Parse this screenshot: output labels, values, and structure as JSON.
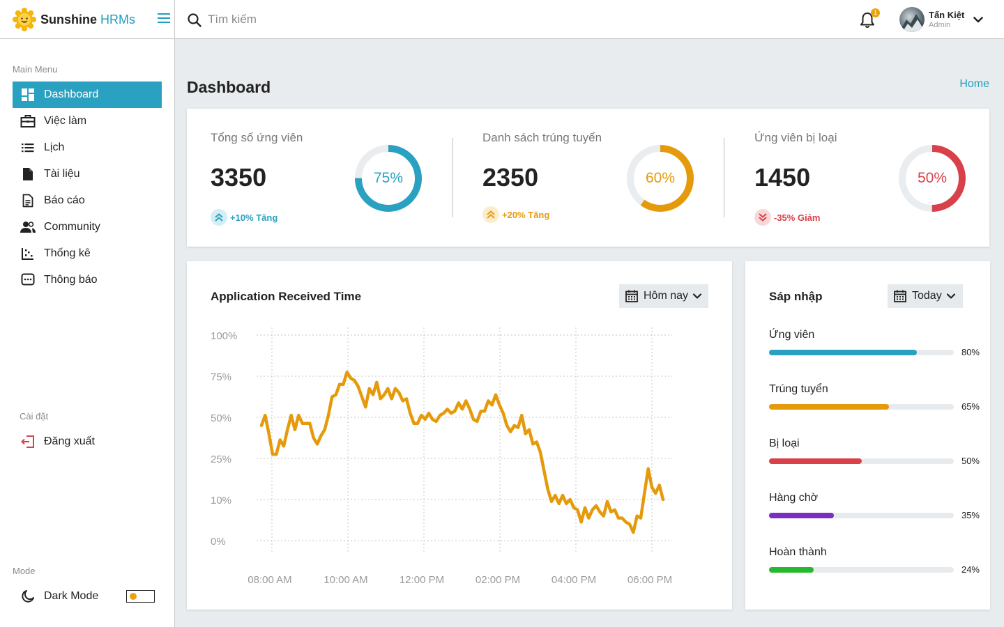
{
  "brand": {
    "name_part1": "Sunshine",
    "name_part2": "HRMs"
  },
  "search": {
    "placeholder": "Tìm kiếm"
  },
  "notifications": {
    "count": "1"
  },
  "user": {
    "name": "Tấn Kiệt",
    "role": "Admin"
  },
  "sidebar": {
    "main_menu_label": "Main Menu",
    "items": [
      {
        "label": "Dashboard",
        "icon": "dashboard-icon",
        "active": true
      },
      {
        "label": "Việc làm",
        "icon": "briefcase-icon"
      },
      {
        "label": "Lịch",
        "icon": "list-icon"
      },
      {
        "label": "Tài liệu",
        "icon": "file-icon"
      },
      {
        "label": "Báo cáo",
        "icon": "report-icon"
      },
      {
        "label": "Community",
        "icon": "community-icon"
      },
      {
        "label": "Thống kê",
        "icon": "scatter-chart-icon"
      },
      {
        "label": "Thông báo",
        "icon": "message-icon"
      }
    ],
    "settings_label": "Cài đặt",
    "logout_label": "Đăng xuất",
    "mode_label": "Mode",
    "dark_mode_label": "Dark Mode",
    "dark_mode_on": false
  },
  "page": {
    "title": "Dashboard",
    "breadcrumb_home": "Home"
  },
  "stats": [
    {
      "title": "Tổng số ứng viên",
      "value": "3350",
      "percent": 75,
      "percent_label": "75%",
      "trend": "+10% Tăng",
      "direction": "up",
      "color": "#2aa1c0",
      "trend_bg": "#d5edf4"
    },
    {
      "title": "Danh sách trúng tuyển",
      "value": "2350",
      "percent": 60,
      "percent_label": "60%",
      "trend": "+20% Tăng",
      "direction": "up",
      "color": "#e59a0c",
      "trend_bg": "#fbeccd"
    },
    {
      "title": "Ứng viên bị loại",
      "value": "1450",
      "percent": 50,
      "percent_label": "50%",
      "trend": "-35% Giảm",
      "direction": "down",
      "color": "#d9414a",
      "trend_bg": "#f8d7d9"
    }
  ],
  "application_chart": {
    "title": "Application Received Time",
    "filter": "Hôm nay"
  },
  "chart_data": {
    "type": "line",
    "title": "Application Received Time",
    "y_tick_labels": [
      "100%",
      "75%",
      "50%",
      "25%",
      "10%",
      "0%"
    ],
    "x_tick_labels": [
      "08:00 AM",
      "10:00 AM",
      "12:00 PM",
      "02:00 PM",
      "04:00 PM",
      "06:00 PM"
    ],
    "y_scale_note": "non-linear labels; values given in tick-band position 0-5 (0=0%,1=10%,2=25%,3=50%,4=75%,5=100%)",
    "x_range": [
      "07:45 AM",
      "06:30 PM"
    ],
    "series": [
      {
        "color": "#e59a0c",
        "values": [
          2.8,
          3.05,
          2.6,
          2.1,
          2.1,
          2.45,
          2.3,
          2.7,
          3.05,
          2.7,
          3.05,
          2.85,
          2.85,
          2.85,
          2.5,
          2.35,
          2.55,
          2.7,
          3.05,
          3.5,
          3.55,
          3.8,
          3.8,
          4.1,
          3.95,
          3.9,
          3.75,
          3.5,
          3.25,
          3.7,
          3.55,
          3.85,
          3.45,
          3.55,
          3.7,
          3.45,
          3.7,
          3.6,
          3.4,
          3.45,
          3.1,
          2.85,
          2.85,
          3.05,
          2.95,
          3.1,
          2.95,
          2.9,
          3.05,
          3.1,
          3.2,
          3.1,
          3.15,
          3.35,
          3.2,
          3.4,
          3.2,
          2.95,
          2.9,
          3.15,
          3.15,
          3.4,
          3.3,
          3.55,
          3.3,
          3.1,
          2.8,
          2.65,
          2.8,
          2.75,
          3.05,
          2.6,
          2.7,
          2.35,
          2.4,
          2.15,
          1.7,
          1.25,
          0.95,
          1.1,
          0.9,
          1.1,
          0.9,
          1.0,
          0.8,
          0.75,
          0.45,
          0.8,
          0.55,
          0.75,
          0.85,
          0.7,
          0.6,
          0.95,
          0.7,
          0.75,
          0.55,
          0.55,
          0.45,
          0.4,
          0.2,
          0.6,
          0.55,
          1.15,
          1.75,
          1.3,
          1.15,
          1.35,
          1.0
        ]
      }
    ],
    "grid": true,
    "grid_style": "dotted"
  },
  "merge_panel": {
    "title": "Sáp nhập",
    "filter": "Today",
    "items": [
      {
        "label": "Ứng viên",
        "percent": 80,
        "percent_label": "80%",
        "color": "#2aa1c0"
      },
      {
        "label": "Trúng tuyển",
        "percent": 65,
        "percent_label": "65%",
        "color": "#e59a0c"
      },
      {
        "label": "Bị loại",
        "percent": 50,
        "percent_label": "50%",
        "color": "#d9414a"
      },
      {
        "label": "Hàng chờ",
        "percent": 35,
        "percent_label": "35%",
        "color": "#7b2ec2"
      },
      {
        "label": "Hoàn thành",
        "percent": 24,
        "percent_label": "24%",
        "color": "#27b82e"
      }
    ]
  }
}
